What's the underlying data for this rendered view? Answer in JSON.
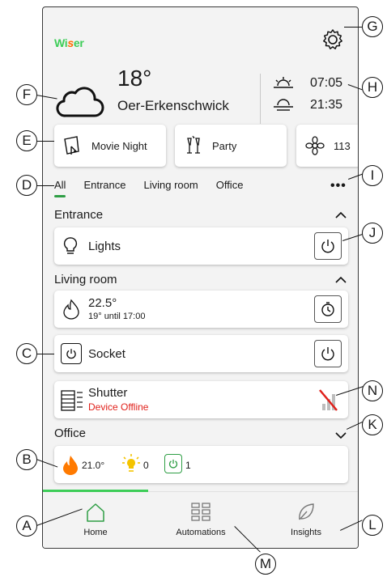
{
  "header": {
    "logo_prefix": "Wi",
    "logo_mid": "s",
    "logo_suffix": "er"
  },
  "weather": {
    "temperature": "18°",
    "city": "Oer-Erkenschwick",
    "sunrise": "07:05",
    "sunset": "21:35"
  },
  "scenes": [
    {
      "label": "Movie Night",
      "icon": "movie-night-icon"
    },
    {
      "label": "Party",
      "icon": "party-icon"
    },
    {
      "label": "113",
      "icon": "flower-icon"
    }
  ],
  "tabs": [
    "All",
    "Entrance",
    "Living room",
    "Office"
  ],
  "more_label": "•••",
  "sections": {
    "entrance": "Entrance",
    "living_room": "Living room",
    "office": "Office"
  },
  "devices": {
    "lights": {
      "label": "Lights"
    },
    "thermostat": {
      "temp": "22.5°",
      "schedule": "19° until 17:00"
    },
    "socket": {
      "label": "Socket"
    },
    "shutter": {
      "label": "Shutter",
      "status": "Device Offline",
      "status_color": "#e0201a"
    }
  },
  "office_summary": {
    "temp": "21.0°",
    "lights": "0",
    "sockets": "1"
  },
  "bottom_nav": [
    {
      "label": "Home",
      "icon": "home-icon"
    },
    {
      "label": "Automations",
      "icon": "automations-icon"
    },
    {
      "label": "Insights",
      "icon": "insights-icon"
    }
  ],
  "callouts": [
    "A",
    "B",
    "C",
    "D",
    "E",
    "F",
    "G",
    "H",
    "I",
    "J",
    "K",
    "L",
    "M",
    "N"
  ],
  "colors": {
    "accent": "#3dcd58",
    "flame": "#ff7a00",
    "bulb": "#f4c400",
    "offline": "#e0201a"
  }
}
